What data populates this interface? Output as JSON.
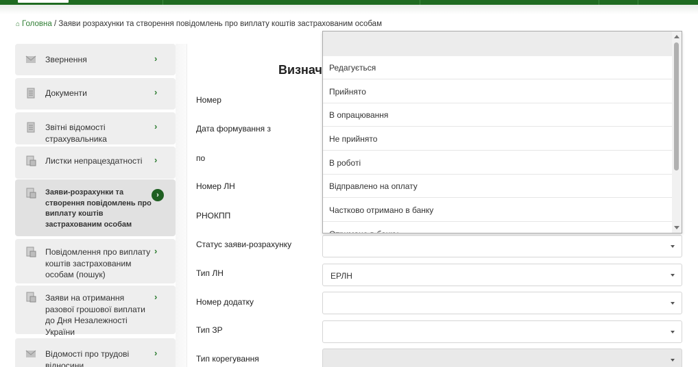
{
  "breadcrumb": {
    "home": "Головна",
    "separator": "/",
    "current": "Заяви розрахунки та створення повідомлень про виплату коштів застрахованим особам"
  },
  "sidebar": {
    "items": [
      {
        "label": "Звернення",
        "icon": "envelope-icon",
        "arrow": "›"
      },
      {
        "label": "Документи",
        "icon": "document-icon",
        "arrow": "›"
      },
      {
        "label": "Звітні відомості страхувальника",
        "icon": "document-icon",
        "arrow": "›"
      },
      {
        "label": "Листки непрацездатності",
        "icon": "sick-leave-icon",
        "arrow": "›"
      },
      {
        "label": "Заяви-розрахунки та створення повідомлень про виплату коштів застрахованим особам",
        "icon": "sick-leave-icon",
        "arrow": "›"
      },
      {
        "label": "Повідомлення про виплату коштів застрахованим особам (пошук)",
        "icon": "sick-leave-icon",
        "arrow": "›"
      },
      {
        "label": "Заяви на отримання разової грошової виплати до Дня Незалежності України",
        "icon": "sick-leave-icon",
        "arrow": "›"
      },
      {
        "label": "Відомості про трудові відносини",
        "icon": "envelope-icon",
        "arrow": "›"
      }
    ]
  },
  "main": {
    "title": "Визнач",
    "fields": {
      "number": "Номер",
      "date_from": "Дата формування з",
      "date_to": "по",
      "ln_number": "Номер ЛН",
      "rnokpp": "РНОКПП",
      "status": "Статус заяви-розрахунку",
      "ln_type": "Тип ЛН",
      "attachment_number": "Номер додатку",
      "zr_type": "Тип ЗР",
      "correction_type": "Тип корегування"
    },
    "values": {
      "status": "",
      "ln_type": "ЕРЛН",
      "attachment_number": "",
      "zr_type": "",
      "correction_type": ""
    }
  },
  "status_dropdown": {
    "options": [
      "Редагується",
      "Прийнято",
      "В опрацювання",
      "Не прийнято",
      "В роботі",
      "Відправлено на оплату",
      "Частково отримано в банку",
      "Отримано в банку"
    ]
  },
  "colors": {
    "brand_green": "#1f6b21",
    "link_green": "#2e7d32",
    "sidebar_bg": "#eeeeee",
    "sidebar_active_bg": "#e1e1e1"
  }
}
